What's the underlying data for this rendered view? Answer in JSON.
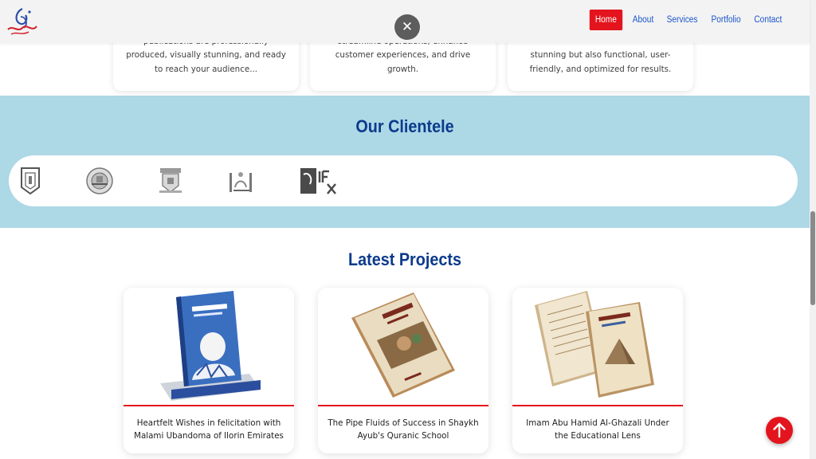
{
  "nav": {
    "items": [
      {
        "label": "Home",
        "active": true
      },
      {
        "label": "About",
        "active": false
      },
      {
        "label": "Services",
        "active": false
      },
      {
        "label": "Portfolio",
        "active": false
      },
      {
        "label": "Contact",
        "active": false
      }
    ]
  },
  "close_button": {
    "glyph": "✕"
  },
  "services": [
    {
      "text": "publications are professionally produced, visually stunning, and ready to reach your audience..."
    },
    {
      "text": "solutions that help businesses streamline operations, enhance customer experiences, and drive growth."
    },
    {
      "text": "stunning but also functional, user-friendly, and optimized for results."
    }
  ],
  "clientele": {
    "title": "Our Clientele",
    "logos": [
      "crest-logo",
      "round-seal-logo",
      "shield-crest-logo",
      "arabic-calligraphy-logo",
      "ifx-logo"
    ]
  },
  "projects": {
    "title": "Latest Projects",
    "items": [
      {
        "title": "Heartfelt Wishes in felicitation with Malami Ubandoma of Ilorin Emirates"
      },
      {
        "title": "The Pipe Fluids of Success in Shaykh Ayub's Quranic School"
      },
      {
        "title": "Imam Abu Hamid Al-Ghazali Under the Educational Lens"
      }
    ]
  },
  "colors": {
    "accent": "#e3141d",
    "heading": "#0b3a8c",
    "nav_link": "#1a56c9",
    "clientele_bg": "#add8e6"
  }
}
